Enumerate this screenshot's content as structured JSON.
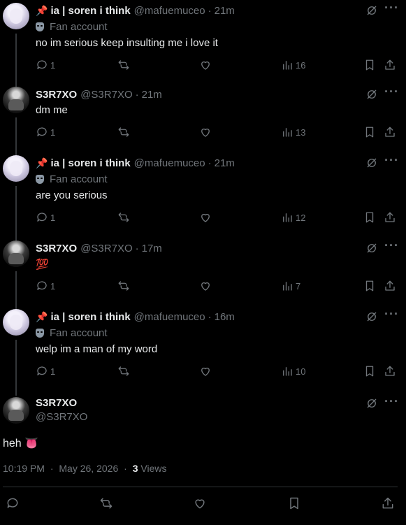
{
  "replies": [
    {
      "pin": "📌",
      "name": "ia | soren i think",
      "handle": "@mafuemuceo",
      "time": "21m",
      "fan_label": "Fan account",
      "text": "no im serious keep insulting me i love it",
      "replies": "1",
      "views": "16",
      "avatar": "ia"
    },
    {
      "pin": "",
      "name": "S3R7XO",
      "handle": "@S3R7XO",
      "time": "21m",
      "fan_label": "",
      "text": "dm me",
      "replies": "1",
      "views": "13",
      "avatar": "s3"
    },
    {
      "pin": "📌",
      "name": "ia | soren i think",
      "handle": "@mafuemuceo",
      "time": "21m",
      "fan_label": "Fan account",
      "text": "are you serious",
      "replies": "1",
      "views": "12",
      "avatar": "ia"
    },
    {
      "pin": "",
      "name": "S3R7XO",
      "handle": "@S3R7XO",
      "time": "17m",
      "fan_label": "",
      "text": "💯",
      "replies": "1",
      "views": "7",
      "avatar": "s3"
    },
    {
      "pin": "📌",
      "name": "ia | soren i think",
      "handle": "@mafuemuceo",
      "time": "16m",
      "fan_label": "Fan account",
      "text": "welp im a man of my word",
      "replies": "1",
      "views": "10",
      "avatar": "ia"
    }
  ],
  "main_tweet": {
    "name": "S3R7XO",
    "handle": "@S3R7XO",
    "text": "heh 👅",
    "time": "10:19 PM",
    "date": "May 26, 2026",
    "views_count": "3",
    "views_label": "Views"
  },
  "separator": "·",
  "more_label": "···",
  "icons": {
    "reply": "reply-icon",
    "retweet": "retweet-icon",
    "like": "heart-icon",
    "views": "views-icon",
    "bookmark": "bookmark-icon",
    "share": "share-icon",
    "grok": "grok-icon",
    "more": "more-icon",
    "fan_badge": "mask-icon",
    "pin": "pin-icon"
  }
}
